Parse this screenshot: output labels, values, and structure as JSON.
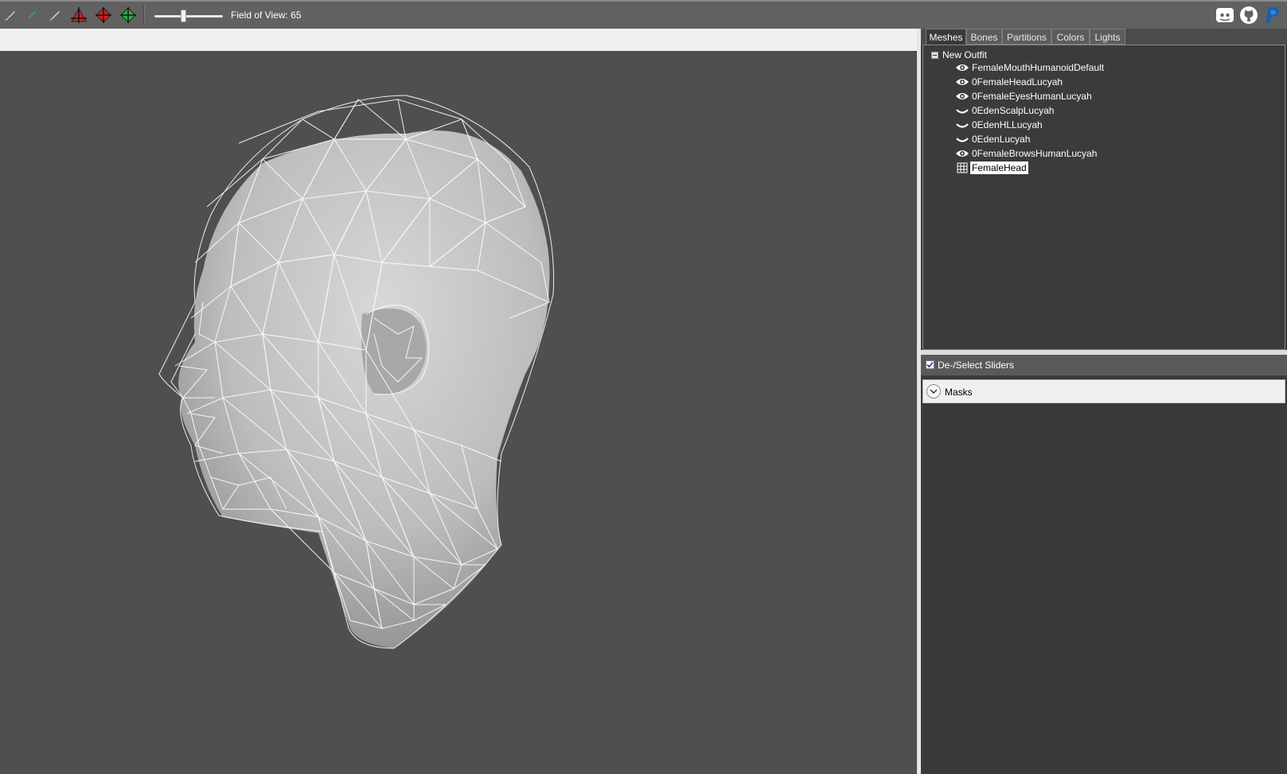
{
  "toolbar": {
    "tools": [
      {
        "icon": "brush-icon",
        "color": "#cfcfcf"
      },
      {
        "icon": "mask-brush-icon",
        "color": "#3aa856"
      },
      {
        "icon": "brush-alt-icon",
        "color": "#cfcfcf"
      },
      {
        "icon": "move-vertex-icon",
        "color": "#d42020"
      },
      {
        "icon": "inflate-icon",
        "color": "#d42020"
      },
      {
        "icon": "deflate-icon",
        "color": "#21b04b"
      }
    ],
    "fov_label": "Field of View: 65",
    "fov_value": 65,
    "social": [
      "discord-icon",
      "github-icon",
      "paypal-icon"
    ]
  },
  "tabs": [
    "Meshes",
    "Bones",
    "Partitions",
    "Colors",
    "Lights"
  ],
  "active_tab": "Meshes",
  "tree": {
    "root": "New Outfit",
    "items": [
      {
        "label": "FemaleMouthHumanoidDefault",
        "icon": "eye-icon",
        "selected": false
      },
      {
        "label": "0FemaleHeadLucyah",
        "icon": "eye-icon",
        "selected": false
      },
      {
        "label": "0FemaleEyesHumanLucyah",
        "icon": "eye-icon",
        "selected": false
      },
      {
        "label": "0EdenScalpLucyah",
        "icon": "eye-closed-icon",
        "selected": false
      },
      {
        "label": "0EdenHLLucyah",
        "icon": "eye-closed-icon",
        "selected": false
      },
      {
        "label": "0EdenLucyah",
        "icon": "eye-closed-icon",
        "selected": false
      },
      {
        "label": "0FemaleBrowsHumanLucyah",
        "icon": "eye-icon",
        "selected": false
      },
      {
        "label": "FemaleHead",
        "icon": "wireframe-grid-icon",
        "selected": true
      }
    ]
  },
  "sliders": {
    "select_label": "De-/Select Sliders",
    "select_checked": true,
    "masks_label": "Masks"
  },
  "viewport": {
    "background": "#4f4f4f",
    "model": "head-mesh-wireframe"
  }
}
